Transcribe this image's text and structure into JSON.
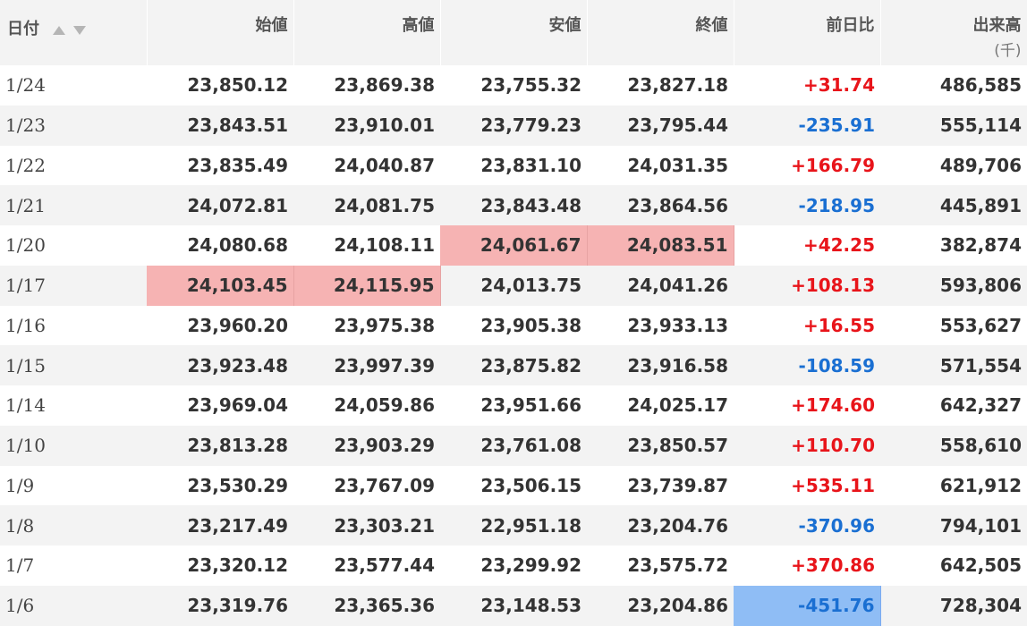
{
  "table": {
    "headers": {
      "date": "日付",
      "open": "始値",
      "high": "高値",
      "low": "安値",
      "close": "終値",
      "change": "前日比",
      "volume": "出来高",
      "volume_unit": "(千)"
    },
    "colors": {
      "positive": "#e8141a",
      "negative": "#1a6fd2",
      "highlight_red": "#f6b3b3",
      "highlight_blue": "#8fbdf5"
    },
    "rows": [
      {
        "date": "1/24",
        "open": "23,850.12",
        "high": "23,869.38",
        "low": "23,755.32",
        "close": "23,827.18",
        "change": "+31.74",
        "volume": "486,585"
      },
      {
        "date": "1/23",
        "open": "23,843.51",
        "high": "23,910.01",
        "low": "23,779.23",
        "close": "23,795.44",
        "change": "-235.91",
        "volume": "555,114"
      },
      {
        "date": "1/22",
        "open": "23,835.49",
        "high": "24,040.87",
        "low": "23,831.10",
        "close": "24,031.35",
        "change": "+166.79",
        "volume": "489,706"
      },
      {
        "date": "1/21",
        "open": "24,072.81",
        "high": "24,081.75",
        "low": "23,843.48",
        "close": "23,864.56",
        "change": "-218.95",
        "volume": "445,891"
      },
      {
        "date": "1/20",
        "open": "24,080.68",
        "high": "24,108.11",
        "low": "24,061.67",
        "close": "24,083.51",
        "change": "+42.25",
        "volume": "382,874"
      },
      {
        "date": "1/17",
        "open": "24,103.45",
        "high": "24,115.95",
        "low": "24,013.75",
        "close": "24,041.26",
        "change": "+108.13",
        "volume": "593,806"
      },
      {
        "date": "1/16",
        "open": "23,960.20",
        "high": "23,975.38",
        "low": "23,905.38",
        "close": "23,933.13",
        "change": "+16.55",
        "volume": "553,627"
      },
      {
        "date": "1/15",
        "open": "23,923.48",
        "high": "23,997.39",
        "low": "23,875.82",
        "close": "23,916.58",
        "change": "-108.59",
        "volume": "571,554"
      },
      {
        "date": "1/14",
        "open": "23,969.04",
        "high": "24,059.86",
        "low": "23,951.66",
        "close": "24,025.17",
        "change": "+174.60",
        "volume": "642,327"
      },
      {
        "date": "1/10",
        "open": "23,813.28",
        "high": "23,903.29",
        "low": "23,761.08",
        "close": "23,850.57",
        "change": "+110.70",
        "volume": "558,610"
      },
      {
        "date": "1/9",
        "open": "23,530.29",
        "high": "23,767.09",
        "low": "23,506.15",
        "close": "23,739.87",
        "change": "+535.11",
        "volume": "621,912"
      },
      {
        "date": "1/8",
        "open": "23,217.49",
        "high": "23,303.21",
        "low": "22,951.18",
        "close": "23,204.76",
        "change": "-370.96",
        "volume": "794,101"
      },
      {
        "date": "1/7",
        "open": "23,320.12",
        "high": "23,577.44",
        "low": "23,299.92",
        "close": "23,575.72",
        "change": "+370.86",
        "volume": "642,505"
      },
      {
        "date": "1/6",
        "open": "23,319.76",
        "high": "23,365.36",
        "low": "23,148.53",
        "close": "23,204.86",
        "change": "-451.76",
        "volume": "728,304"
      }
    ]
  }
}
